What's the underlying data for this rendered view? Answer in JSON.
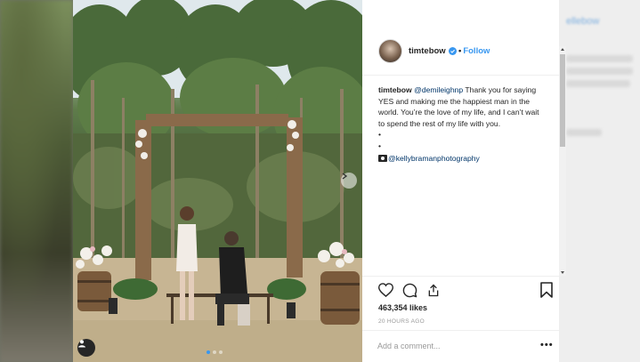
{
  "post": {
    "username": "timtebow",
    "follow_label": "Follow",
    "caption_username": "timtebow",
    "caption_mention": "@demileighnp",
    "caption_text": "Thank you for saying YES and making me the happiest man in the world. You’re the love of my life, and I can’t wait to spend the rest of my life with you.",
    "bullet_1": "•",
    "bullet_2": "•",
    "photographer": "@kellybramanphotography",
    "likes": "463,354 likes",
    "timestamp": "20 HOURS AGO",
    "comment_placeholder": "Add a comment...",
    "more_label": "•••"
  },
  "background_right": {
    "link": "ellebow"
  },
  "colors": {
    "link_blue": "#3897f0",
    "text": "#262626",
    "muted": "#999999",
    "verified": "#3897f0"
  }
}
